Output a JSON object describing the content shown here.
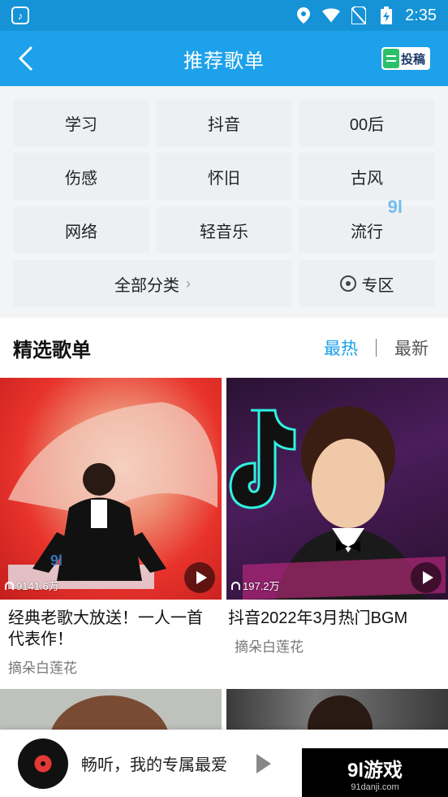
{
  "status_bar": {
    "time": "2:35",
    "app_icon": "music-note-icon"
  },
  "header": {
    "title": "推荐歌单",
    "back_icon": "chevron-left-icon",
    "submit_label": "投稿"
  },
  "categories": {
    "row1": [
      "学习",
      "抖音",
      "00后"
    ],
    "row2": [
      "伤感",
      "怀旧",
      "古风"
    ],
    "row3": [
      "网络",
      "轻音乐",
      "流行"
    ],
    "all_label": "全部分类",
    "zone_label": "专区"
  },
  "section": {
    "title": "精选歌单",
    "sort_hot": "最热",
    "sort_new": "最新"
  },
  "playlists": [
    {
      "title": "经典老歌大放送！一人一首代表作！",
      "author": "摘朵白莲花",
      "plays": "9141.6万"
    },
    {
      "title": "抖音2022年3月热门BGM",
      "author": "摘朵白莲花",
      "plays": "197.2万"
    }
  ],
  "player": {
    "text": "畅听，我的专属最爱"
  },
  "watermark": {
    "brand": "9l游戏",
    "domain": "91danji.com"
  },
  "colors": {
    "accent": "#1da1ea",
    "header_bg": "#1da1ea"
  }
}
